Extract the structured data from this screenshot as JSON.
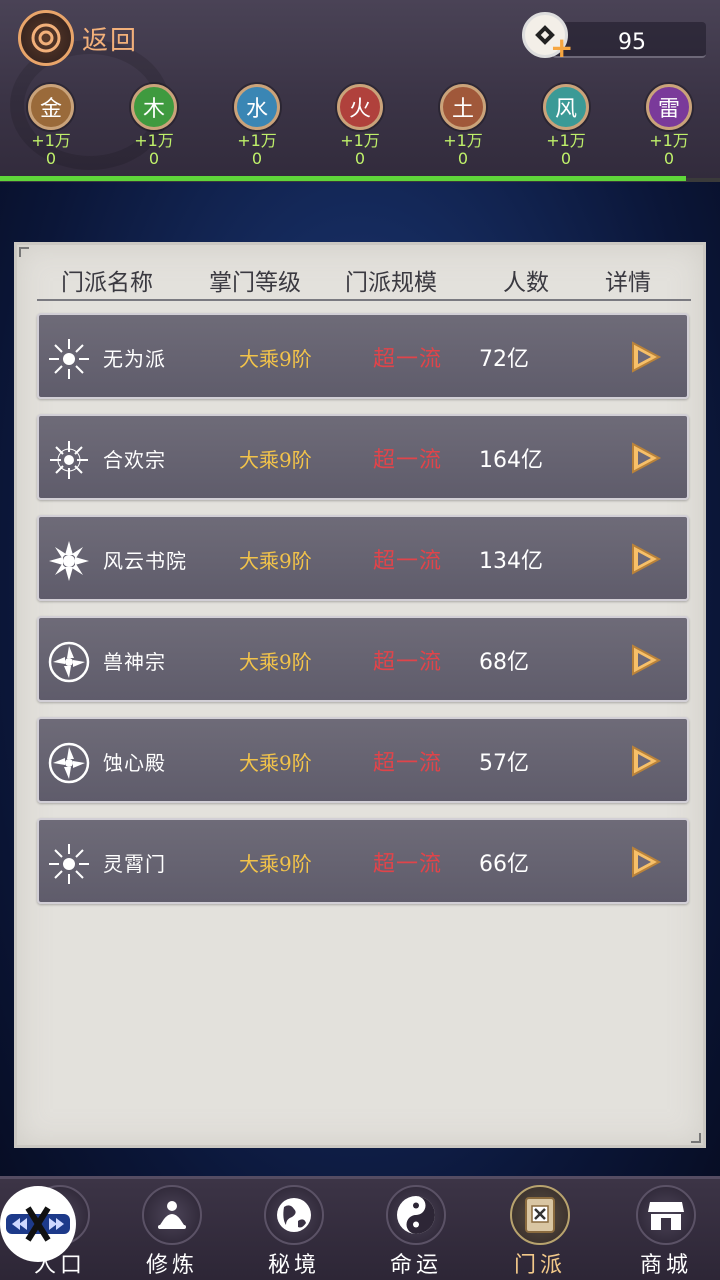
{
  "header": {
    "back_label": "返回",
    "currency_value": "95"
  },
  "elements": [
    {
      "name": "金",
      "gain": "+1万",
      "count": "0",
      "color": "#9a6a3a"
    },
    {
      "name": "木",
      "gain": "+1万",
      "count": "0",
      "color": "#3f9a3f"
    },
    {
      "name": "水",
      "gain": "+1万",
      "count": "0",
      "color": "#3a86b4"
    },
    {
      "name": "火",
      "gain": "+1万",
      "count": "0",
      "color": "#b0413c"
    },
    {
      "name": "土",
      "gain": "+1万",
      "count": "0",
      "color": "#a0583a"
    },
    {
      "name": "风",
      "gain": "+1万",
      "count": "0",
      "color": "#3b9a96"
    },
    {
      "name": "雷",
      "gain": "+1万",
      "count": "0",
      "color": "#7a3a9a"
    }
  ],
  "table": {
    "columns": [
      "门派名称",
      "掌门等级",
      "门派规模",
      "人数",
      "详情"
    ],
    "rows": [
      {
        "name": "无为派",
        "level": "大乘9阶",
        "scale": "超一流",
        "people": "72亿"
      },
      {
        "name": "合欢宗",
        "level": "大乘9阶",
        "scale": "超一流",
        "people": "164亿"
      },
      {
        "name": "风云书院",
        "level": "大乘9阶",
        "scale": "超一流",
        "people": "134亿"
      },
      {
        "name": "兽神宗",
        "level": "大乘9阶",
        "scale": "超一流",
        "people": "68亿"
      },
      {
        "name": "蚀心殿",
        "level": "大乘9阶",
        "scale": "超一流",
        "people": "57亿"
      },
      {
        "name": "灵霄门",
        "level": "大乘9阶",
        "scale": "超一流",
        "people": "66亿"
      }
    ]
  },
  "nav": [
    {
      "label": "人口",
      "icon": "home-icon"
    },
    {
      "label": "修炼",
      "icon": "meditation-icon"
    },
    {
      "label": "秘境",
      "icon": "globe-icon"
    },
    {
      "label": "命运",
      "icon": "yin-yang-icon"
    },
    {
      "label": "门派",
      "icon": "sect-book-icon"
    },
    {
      "label": "商城",
      "icon": "shop-icon"
    }
  ]
}
